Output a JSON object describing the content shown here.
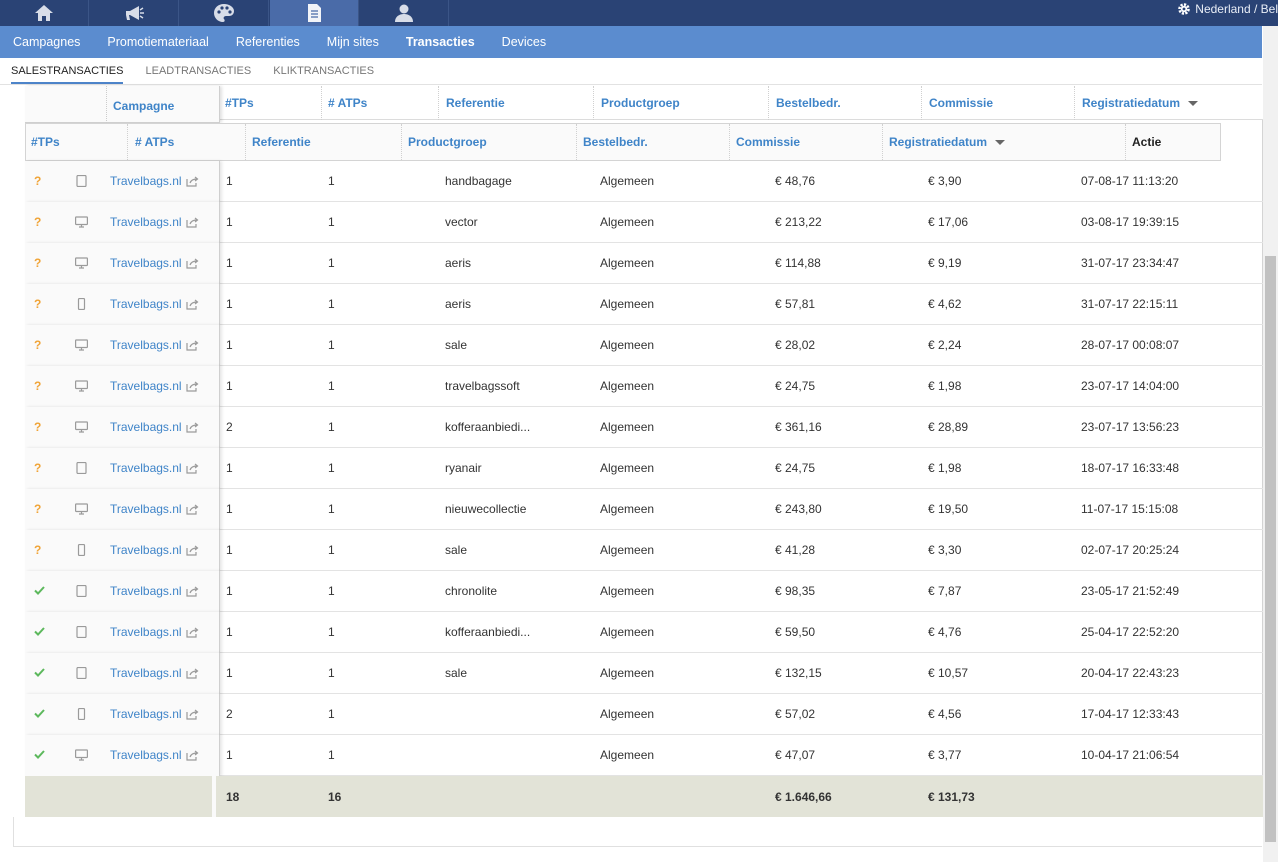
{
  "topbar": {
    "tabs": [
      {
        "icon": "home-icon"
      },
      {
        "icon": "megaphone-icon"
      },
      {
        "icon": "palette-icon"
      },
      {
        "icon": "document-icon",
        "active": true
      },
      {
        "icon": "user-icon"
      }
    ],
    "country": "Nederland / Bel"
  },
  "mainnav": {
    "items": [
      "Campagnes",
      "Promotiemateriaal",
      "Referenties",
      "Mijn sites",
      "Transacties",
      "Devices"
    ],
    "active": "Transacties"
  },
  "subnav": {
    "items": [
      "SALESTRANSACTIES",
      "LEADTRANSACTIES",
      "KLIKTRANSACTIES"
    ],
    "active": "SALESTRANSACTIES"
  },
  "header1": {
    "campagne": "Campagne",
    "tps": "#TPs",
    "atps": "# ATPs",
    "referentie": "Referentie",
    "productgroep": "Productgroep",
    "bestelbedr": "Bestelbedr.",
    "commissie": "Commissie",
    "registratiedatum": "Registratiedatum"
  },
  "header2": {
    "tps": "#TPs",
    "atps": "# ATPs",
    "referentie": "Referentie",
    "productgroep": "Productgroep",
    "bestelbedr": "Bestelbedr.",
    "commissie": "Commissie",
    "registratiedatum": "Registratiedatum",
    "actie": "Actie"
  },
  "rows": [
    {
      "status": "?",
      "device": "tablet",
      "campagne": "Travelbags.nl",
      "tps": "1",
      "atps": "1",
      "referentie": "handbagage",
      "productgroep": "Algemeen",
      "bestelbedr": "€ 48,76",
      "commissie": "€ 3,90",
      "datum": "07-08-17 11:13:20"
    },
    {
      "status": "?",
      "device": "desktop",
      "campagne": "Travelbags.nl",
      "tps": "1",
      "atps": "1",
      "referentie": "vector",
      "productgroep": "Algemeen",
      "bestelbedr": "€ 213,22",
      "commissie": "€ 17,06",
      "datum": "03-08-17 19:39:15"
    },
    {
      "status": "?",
      "device": "desktop",
      "campagne": "Travelbags.nl",
      "tps": "1",
      "atps": "1",
      "referentie": "aeris",
      "productgroep": "Algemeen",
      "bestelbedr": "€ 114,88",
      "commissie": "€ 9,19",
      "datum": "31-07-17 23:34:47"
    },
    {
      "status": "?",
      "device": "mobile",
      "campagne": "Travelbags.nl",
      "tps": "1",
      "atps": "1",
      "referentie": "aeris",
      "productgroep": "Algemeen",
      "bestelbedr": "€ 57,81",
      "commissie": "€ 4,62",
      "datum": "31-07-17 22:15:11"
    },
    {
      "status": "?",
      "device": "desktop",
      "campagne": "Travelbags.nl",
      "tps": "1",
      "atps": "1",
      "referentie": "sale",
      "productgroep": "Algemeen",
      "bestelbedr": "€ 28,02",
      "commissie": "€ 2,24",
      "datum": "28-07-17 00:08:07"
    },
    {
      "status": "?",
      "device": "desktop",
      "campagne": "Travelbags.nl",
      "tps": "1",
      "atps": "1",
      "referentie": "travelbagssoft",
      "productgroep": "Algemeen",
      "bestelbedr": "€ 24,75",
      "commissie": "€ 1,98",
      "datum": "23-07-17 14:04:00"
    },
    {
      "status": "?",
      "device": "desktop",
      "campagne": "Travelbags.nl",
      "tps": "2",
      "atps": "1",
      "referentie": "kofferaanbiedi...",
      "productgroep": "Algemeen",
      "bestelbedr": "€ 361,16",
      "commissie": "€ 28,89",
      "datum": "23-07-17 13:56:23"
    },
    {
      "status": "?",
      "device": "tablet",
      "campagne": "Travelbags.nl",
      "tps": "1",
      "atps": "1",
      "referentie": "ryanair",
      "productgroep": "Algemeen",
      "bestelbedr": "€ 24,75",
      "commissie": "€ 1,98",
      "datum": "18-07-17 16:33:48"
    },
    {
      "status": "?",
      "device": "desktop",
      "campagne": "Travelbags.nl",
      "tps": "1",
      "atps": "1",
      "referentie": "nieuwecollectie",
      "productgroep": "Algemeen",
      "bestelbedr": "€ 243,80",
      "commissie": "€ 19,50",
      "datum": "11-07-17 15:15:08"
    },
    {
      "status": "?",
      "device": "mobile",
      "campagne": "Travelbags.nl",
      "tps": "1",
      "atps": "1",
      "referentie": "sale",
      "productgroep": "Algemeen",
      "bestelbedr": "€ 41,28",
      "commissie": "€ 3,30",
      "datum": "02-07-17 20:25:24"
    },
    {
      "status": "ok",
      "device": "tablet",
      "campagne": "Travelbags.nl",
      "tps": "1",
      "atps": "1",
      "referentie": "chronolite",
      "productgroep": "Algemeen",
      "bestelbedr": "€ 98,35",
      "commissie": "€ 7,87",
      "datum": "23-05-17 21:52:49"
    },
    {
      "status": "ok",
      "device": "tablet",
      "campagne": "Travelbags.nl",
      "tps": "1",
      "atps": "1",
      "referentie": "kofferaanbiedi...",
      "productgroep": "Algemeen",
      "bestelbedr": "€ 59,50",
      "commissie": "€ 4,76",
      "datum": "25-04-17 22:52:20"
    },
    {
      "status": "ok",
      "device": "tablet",
      "campagne": "Travelbags.nl",
      "tps": "1",
      "atps": "1",
      "referentie": "sale",
      "productgroep": "Algemeen",
      "bestelbedr": "€ 132,15",
      "commissie": "€ 10,57",
      "datum": "20-04-17 22:43:23"
    },
    {
      "status": "ok",
      "device": "mobile",
      "campagne": "Travelbags.nl",
      "tps": "2",
      "atps": "1",
      "referentie": "",
      "productgroep": "Algemeen",
      "bestelbedr": "€ 57,02",
      "commissie": "€ 4,56",
      "datum": "17-04-17 12:33:43"
    },
    {
      "status": "ok",
      "device": "desktop",
      "campagne": "Travelbags.nl",
      "tps": "1",
      "atps": "1",
      "referentie": "",
      "productgroep": "Algemeen",
      "bestelbedr": "€ 47,07",
      "commissie": "€ 3,77",
      "datum": "10-04-17 21:06:54"
    }
  ],
  "totals": {
    "tps": "18",
    "atps": "16",
    "bestelbedr": "€ 1.646,66",
    "commissie": "€ 131,73"
  },
  "colors": {
    "topbar": "#2a4375",
    "mainnav": "#5b8ccf",
    "link": "#3f84c8",
    "pending": "#f0a437",
    "approved": "#5cb85c",
    "totals": "#e2e3d7"
  }
}
